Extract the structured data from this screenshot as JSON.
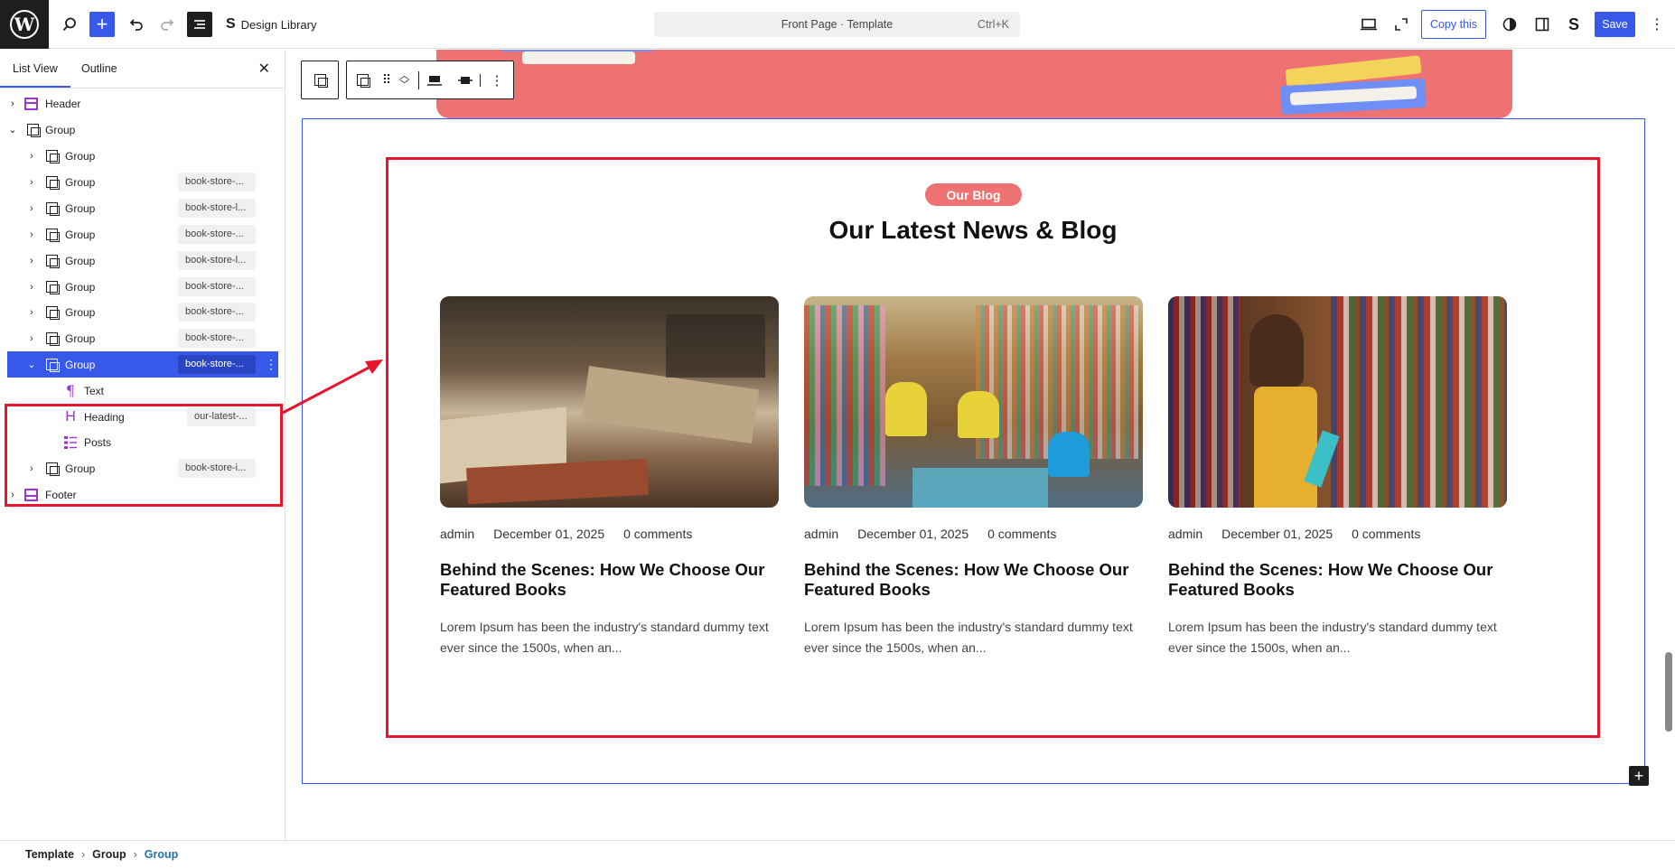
{
  "topbar": {
    "design_library": "Design Library",
    "doc_title": "Front Page · Template",
    "doc_shortcut": "Ctrl+K",
    "copy_label": "Copy this",
    "save_label": "Save"
  },
  "sidebar": {
    "tabs": [
      "List View",
      "Outline"
    ],
    "rows": [
      {
        "label": "Header",
        "tag": ""
      },
      {
        "label": "Group",
        "tag": ""
      },
      {
        "label": "Group",
        "tag": ""
      },
      {
        "label": "Group",
        "tag": "book-store-..."
      },
      {
        "label": "Group",
        "tag": "book-store-l..."
      },
      {
        "label": "Group",
        "tag": "book-store-..."
      },
      {
        "label": "Group",
        "tag": "book-store-l..."
      },
      {
        "label": "Group",
        "tag": "book-store-..."
      },
      {
        "label": "Group",
        "tag": "book-store-..."
      },
      {
        "label": "Group",
        "tag": "book-store-..."
      },
      {
        "label": "Group",
        "tag": "book-store-..."
      },
      {
        "label": "Text",
        "tag": ""
      },
      {
        "label": "Heading",
        "tag": "our-latest-..."
      },
      {
        "label": "Posts",
        "tag": ""
      },
      {
        "label": "Group",
        "tag": "book-store-i..."
      },
      {
        "label": "Footer",
        "tag": ""
      }
    ]
  },
  "breadcrumb": [
    "Template",
    "Group",
    "Group"
  ],
  "blog": {
    "badge": "Our Blog",
    "heading": "Our Latest News & Blog",
    "posts": [
      {
        "author": "admin",
        "date": "December 01, 2025",
        "comments": "0 comments",
        "title": "Behind the Scenes: How We Choose Our Featured Books",
        "excerpt": "Lorem Ipsum has been the industry's standard dummy text ever since the 1500s, when an..."
      },
      {
        "author": "admin",
        "date": "December 01, 2025",
        "comments": "0 comments",
        "title": "Behind the Scenes: How We Choose Our Featured Books",
        "excerpt": "Lorem Ipsum has been the industry's standard dummy text ever since the 1500s, when an..."
      },
      {
        "author": "admin",
        "date": "December 01, 2025",
        "comments": "0 comments",
        "title": "Behind the Scenes: How We Choose Our Featured Books",
        "excerpt": "Lorem Ipsum has been the industry's standard dummy text ever since the 1500s, when an..."
      }
    ]
  },
  "colors": {
    "accent": "#3858e9",
    "brand": "#ef7272",
    "highlight": "#e8142c"
  }
}
